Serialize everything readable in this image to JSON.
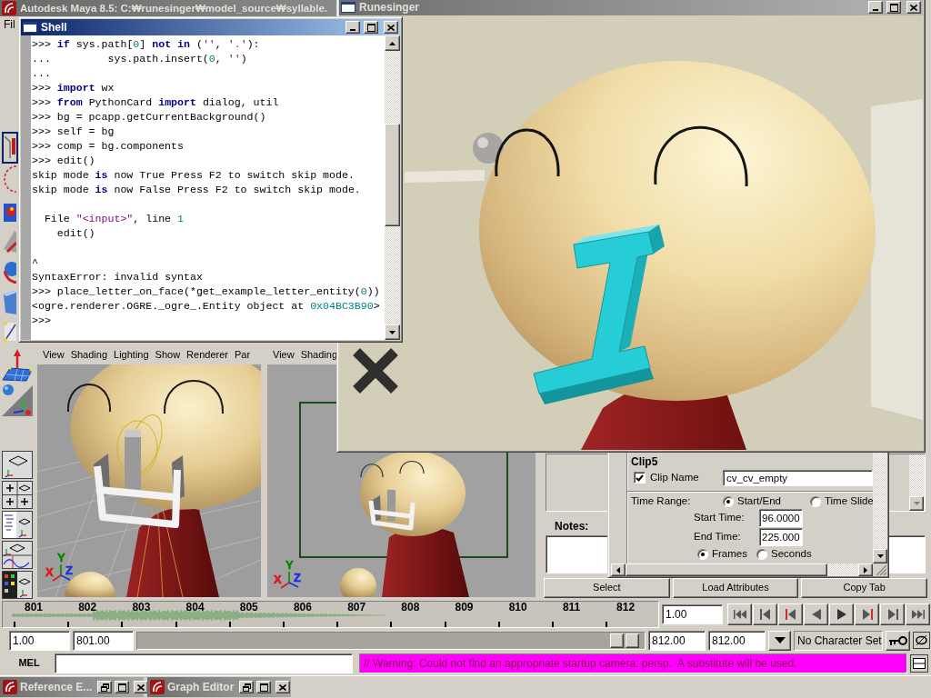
{
  "maya": {
    "title": "Autodesk Maya 8.5: C:₩runesinger₩model_source₩syllable.",
    "active": false,
    "menu": [
      "Fil"
    ],
    "tools": [
      {
        "selected": true
      },
      {
        "selected": false
      },
      {
        "selected": false
      },
      {
        "selected": false
      },
      {
        "selected": false
      },
      {
        "selected": false
      },
      {
        "selected": false
      }
    ],
    "viewports": [
      {
        "kind": "perspective",
        "menu": [
          "View",
          "Shading",
          "Lighting",
          "Show",
          "Renderer",
          "Par"
        ],
        "axes": [
          {
            "label": "X",
            "color": "#e01818"
          },
          {
            "label": "Y",
            "color": "#008a00"
          },
          {
            "label": "Z",
            "color": "#1830e0"
          }
        ]
      },
      {
        "kind": "camera",
        "menu": [
          "View",
          "Shading"
        ],
        "axes": [
          {
            "label": "X",
            "color": "#e01818"
          },
          {
            "label": "Y",
            "color": "#008a00"
          },
          {
            "label": "Z",
            "color": "#1830e0"
          }
        ]
      }
    ],
    "attribute_editor": {
      "notes_label": "Notes:",
      "buttons": [
        "Select",
        "Load Attributes",
        "Copy Tab"
      ]
    },
    "timeline": {
      "frames": [
        "801",
        "802",
        "803",
        "804",
        "805",
        "806",
        "807",
        "808",
        "809",
        "810",
        "811",
        "812"
      ],
      "current_frame": "1.00"
    },
    "range_slider": {
      "start": "1.00",
      "range_start": "801.00",
      "range_end": "812.00",
      "end": "812.00",
      "character_set": "No Character Set"
    },
    "command_line": {
      "language": "MEL",
      "message": "// Warning: Could not find an appropriate startup camera: persp.  A substitute will be used."
    },
    "minimized_windows": [
      {
        "title": "Reference E..."
      },
      {
        "title": "Graph Editor"
      }
    ]
  },
  "clip_editor": {
    "clip": "Clip5",
    "clip_name": {
      "label": "Clip Name",
      "checked": true,
      "value": "cv_cv_empty"
    },
    "time_range": {
      "label": "Time Range:",
      "options": [
        {
          "label": "Start/End",
          "selected": true
        },
        {
          "label": "Time Slide",
          "selected": false
        }
      ]
    },
    "start_time": {
      "label": "Start Time:",
      "value": "96.0000"
    },
    "end_time": {
      "label": "End Time:",
      "value": "225.000"
    },
    "units": [
      {
        "label": "Frames",
        "selected": true
      },
      {
        "label": "Seconds",
        "selected": false
      }
    ]
  },
  "runesinger": {
    "title": "Runesinger",
    "active": false
  },
  "shell": {
    "title": "Shell",
    "active": true,
    "lines": [
      {
        "kind": "code",
        "segments": [
          {
            "text": ">>> "
          },
          {
            "text": "if",
            "kind": "keyword"
          },
          {
            "text": " sys.path["
          },
          {
            "text": "0",
            "kind": "number"
          },
          {
            "text": "] "
          },
          {
            "text": "not in",
            "kind": "keyword"
          },
          {
            "text": " ("
          },
          {
            "text": "''",
            "kind": "string"
          },
          {
            "text": ", "
          },
          {
            "text": "'.'",
            "kind": "string"
          },
          {
            "text": "):"
          }
        ]
      },
      {
        "kind": "code",
        "segments": [
          {
            "text": "...         sys.path.insert("
          },
          {
            "text": "0",
            "kind": "number"
          },
          {
            "text": ", "
          },
          {
            "text": "''",
            "kind": "string"
          },
          {
            "text": ")"
          }
        ]
      },
      {
        "kind": "code",
        "segments": [
          {
            "text": "..."
          }
        ]
      },
      {
        "kind": "code",
        "segments": [
          {
            "text": ">>> "
          },
          {
            "text": "import",
            "kind": "keyword"
          },
          {
            "text": " wx"
          }
        ]
      },
      {
        "kind": "code",
        "segments": [
          {
            "text": ">>> "
          },
          {
            "text": "from",
            "kind": "keyword"
          },
          {
            "text": " PythonCard "
          },
          {
            "text": "import",
            "kind": "keyword"
          },
          {
            "text": " dialog, util"
          }
        ]
      },
      {
        "kind": "code",
        "segments": [
          {
            "text": ">>> bg = pcapp.getCurrentBackground()"
          }
        ]
      },
      {
        "kind": "code",
        "segments": [
          {
            "text": ">>> self = bg"
          }
        ]
      },
      {
        "kind": "code",
        "segments": [
          {
            "text": ">>> comp = bg.components"
          }
        ]
      },
      {
        "kind": "code",
        "segments": [
          {
            "text": ">>> edit()"
          }
        ]
      },
      {
        "kind": "code",
        "segments": [
          {
            "text": "skip mode "
          },
          {
            "text": "is",
            "kind": "keyword"
          },
          {
            "text": " now True Press F2 to switch skip mode."
          }
        ]
      },
      {
        "kind": "code",
        "segments": [
          {
            "text": "skip mode "
          },
          {
            "text": "is",
            "kind": "keyword"
          },
          {
            "text": " now False Press F2 to switch skip mode."
          }
        ]
      },
      {
        "kind": "blank"
      },
      {
        "kind": "code",
        "segments": [
          {
            "text": "  File "
          },
          {
            "text": "\"<input>\"",
            "kind": "string"
          },
          {
            "text": ", line "
          },
          {
            "text": "1",
            "kind": "number"
          }
        ]
      },
      {
        "kind": "code",
        "segments": [
          {
            "text": "    edit()"
          }
        ]
      },
      {
        "kind": "blank"
      },
      {
        "kind": "code",
        "segments": [
          {
            "text": "^"
          }
        ]
      },
      {
        "kind": "code",
        "segments": [
          {
            "text": "SyntaxError: invalid syntax"
          }
        ]
      },
      {
        "kind": "code",
        "segments": [
          {
            "text": ">>> place_letter_on_face(*get_example_letter_entity("
          },
          {
            "text": "0",
            "kind": "number"
          },
          {
            "text": "))"
          }
        ]
      },
      {
        "kind": "code",
        "segments": [
          {
            "text": "<ogre.renderer.OGRE._ogre_.Entity object at "
          },
          {
            "text": "0x04BC3B90",
            "kind": "number"
          },
          {
            "text": ">"
          }
        ]
      },
      {
        "kind": "code",
        "segments": [
          {
            "text": ">>>"
          }
        ]
      }
    ]
  }
}
